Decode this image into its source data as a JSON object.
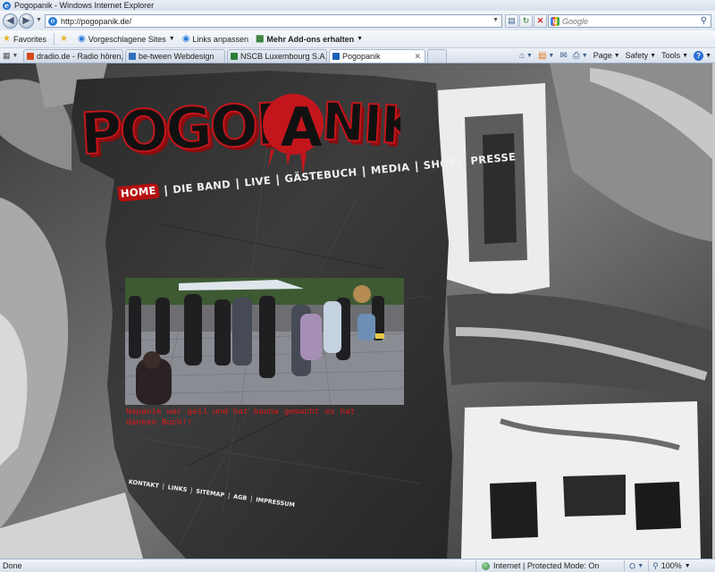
{
  "window": {
    "title": "Pogopanik - Windows Internet Explorer"
  },
  "address": {
    "url": "http://pogopanik.de/",
    "search_placeholder": "Google"
  },
  "favorites_bar": {
    "favorites_label": "Favorites",
    "items": [
      {
        "label": "Vorgeschlagene Sites",
        "dropdown": true
      },
      {
        "label": "Links anpassen",
        "dropdown": false
      },
      {
        "label": "Mehr Add-ons erhalten",
        "dropdown": true
      }
    ]
  },
  "tabs": [
    {
      "label": "dradio.de - Radio hören, w...",
      "color": "#d64a1a"
    },
    {
      "label": "be-tween Webdesign",
      "color": "#2f6fb8"
    },
    {
      "label": "NSCB Luxembourg S.A.: H...",
      "color": "#2e7d3a"
    },
    {
      "label": "Pogopanik",
      "color": "#1d5fb5",
      "active": true
    }
  ],
  "command_bar": {
    "page": "Page",
    "safety": "Safety",
    "tools": "Tools",
    "help": "?"
  },
  "site": {
    "logo_text": "POGOPANIK",
    "logo_left": "POGOP",
    "logo_a": "A",
    "logo_right": "NIK",
    "nav": [
      {
        "label": "HOME",
        "active": true
      },
      {
        "label": "DIE BAND"
      },
      {
        "label": "LIVE"
      },
      {
        "label": "GÄSTEBUCH"
      },
      {
        "label": "MEDIA"
      },
      {
        "label": "SHOP"
      },
      {
        "label": "PRESSE"
      }
    ],
    "nav_separator": "|",
    "caption": "Napanik war geil und hat bauna gemacht es hat danken Buch!!",
    "footer_nav": [
      "KONTAKT",
      "LINKS",
      "SITEMAP",
      "AGB",
      "IMPRESSUM"
    ],
    "colors": {
      "brand_red": "#c3161c",
      "caption_red": "#e01818",
      "nav_active_bg": "#b50f0f"
    }
  },
  "status": {
    "left": "Done",
    "zone": "Internet | Protected Mode: On",
    "zoom": "100%"
  }
}
